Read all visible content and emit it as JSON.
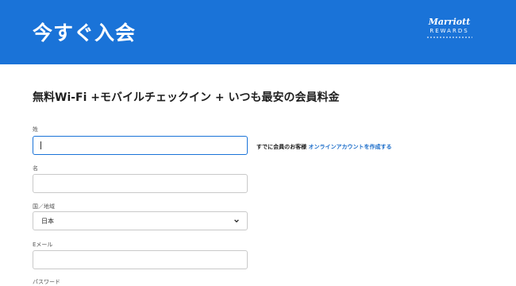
{
  "header": {
    "title": "今すぐ入会",
    "logo_brand": "Marriott",
    "logo_sub": "REWARDS",
    "bg_color": "#1a73d8"
  },
  "promo": {
    "text": "無料Wi-Fi +モバイルチェックイン + いつも最安の会員料金"
  },
  "form": {
    "last_name_label": "姓",
    "last_name_value": "",
    "first_name_label": "名",
    "first_name_value": "",
    "country_label": "国／地域",
    "country_value": "日本",
    "email_label": "Eメール",
    "email_value": "",
    "password_label": "パスワード"
  },
  "aside": {
    "text": "すでに会員のお客様",
    "link_text": "オンラインアカウントを作成する",
    "link_color": "#1a6cc9"
  },
  "icons": [
    "chevron-down-icon",
    "marriott-rewards-logo"
  ]
}
